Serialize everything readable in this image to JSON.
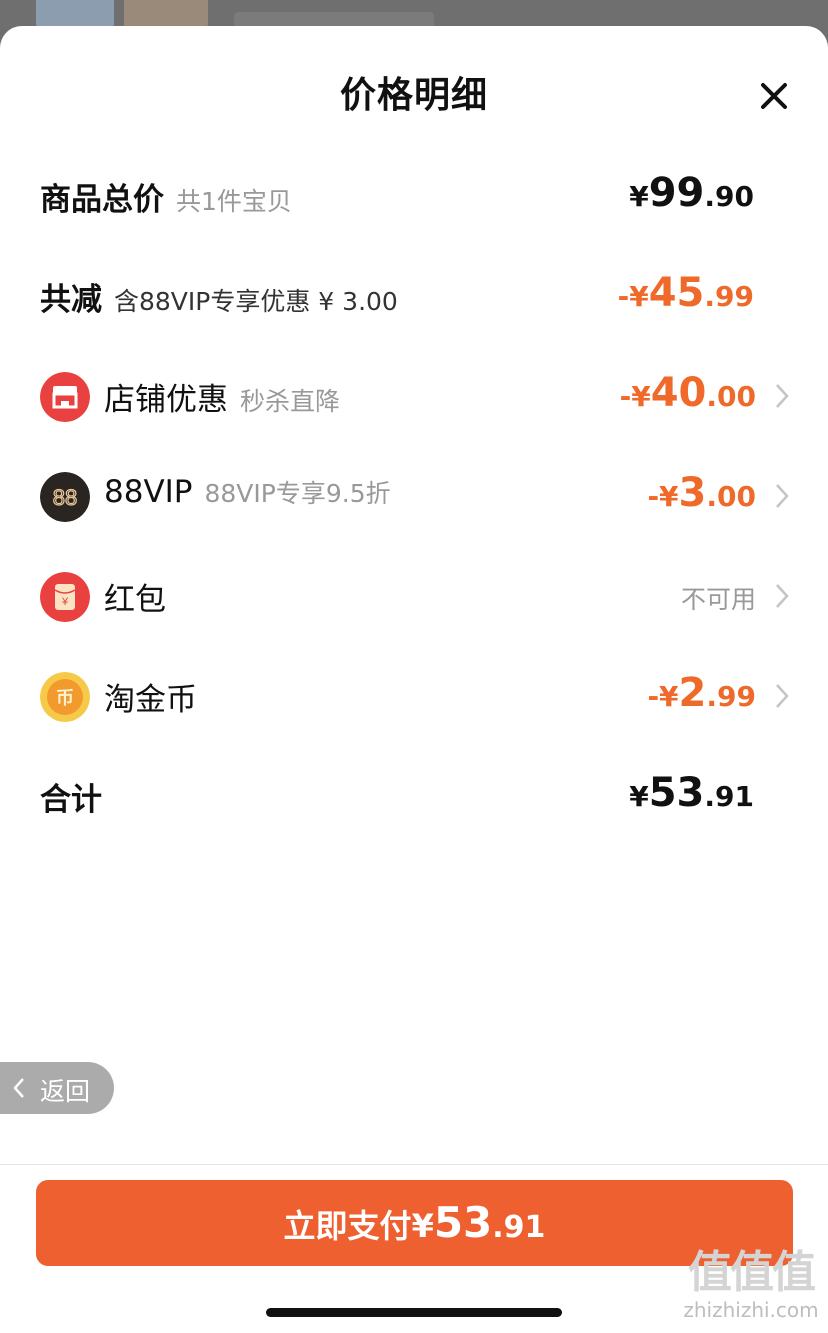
{
  "sheet": {
    "title": "价格明细",
    "close_icon": "close-icon"
  },
  "rows": {
    "total_goods": {
      "label": "商品总价",
      "sub": "共1件宝贝",
      "currency": "¥",
      "int": "99",
      "dec": ".90"
    },
    "total_reduce": {
      "label": "共减",
      "sub": "含88VIP专享优惠 ¥ 3.00",
      "prefix": "-¥",
      "int": "45",
      "dec": ".99",
      "color": "#ef6a2a"
    },
    "shop_discount": {
      "icon": "shop-icon",
      "label": "店铺优惠",
      "sub": "秒杀直降",
      "prefix": "-¥",
      "int": "40",
      "dec": ".00"
    },
    "vip": {
      "icon": "88vip-icon",
      "icon_text": "88",
      "label": "88VIP",
      "sub": "88VIP专享9.5折",
      "prefix": "-¥",
      "int": "3",
      "dec": ".00"
    },
    "red_packet": {
      "icon": "red-packet-icon",
      "icon_text": "¥",
      "label": "红包",
      "status": "不可用"
    },
    "coins": {
      "icon": "taojinbi-coin-icon",
      "icon_text": "币",
      "label": "淘金币",
      "prefix": "-¥",
      "int": "2",
      "dec": ".99"
    },
    "subtotal": {
      "label": "合计",
      "currency": "¥",
      "int": "53",
      "dec": ".91"
    }
  },
  "back": {
    "label": "返回",
    "icon": "chevron-left-icon"
  },
  "pay_button": {
    "label": "立即支付",
    "currency": "¥",
    "int": "53",
    "dec": ".91",
    "color": "#ee6030"
  },
  "watermark": {
    "logo": "值值值",
    "url": "zhizhizhi.com"
  }
}
